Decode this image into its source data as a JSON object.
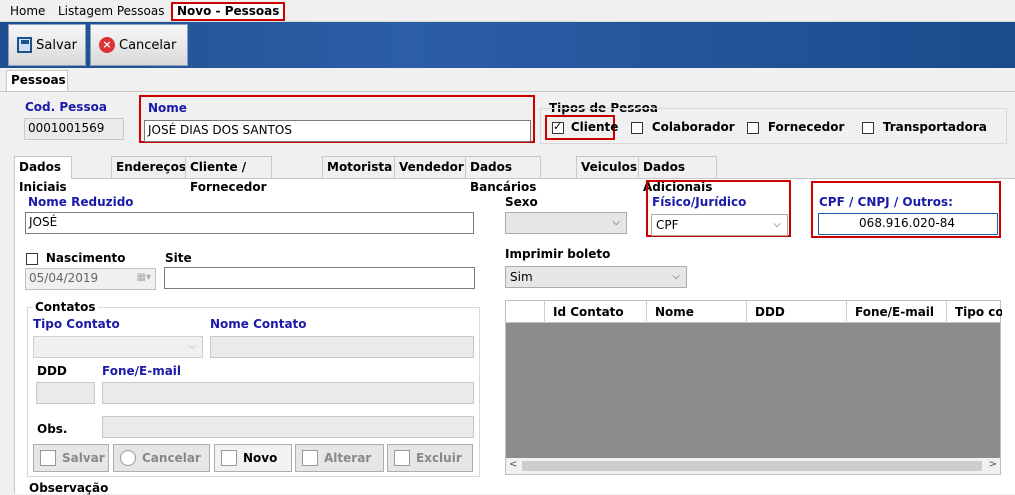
{
  "top_tabs": [
    "Home",
    "Listagem Pessoas",
    "Novo - Pessoas"
  ],
  "toolbar": {
    "save_label": "Salvar",
    "cancel_label": "Cancelar"
  },
  "section_tab": "Pessoas",
  "cod_pessoa": {
    "label": "Cod. Pessoa",
    "value": "0001001569"
  },
  "nome": {
    "label": "Nome",
    "value": "JOSÉ DIAS DOS SANTOS"
  },
  "tipos_pessoa": {
    "label": "Tipos de Pessoa",
    "options": [
      {
        "label": "Cliente",
        "checked": true
      },
      {
        "label": "Colaborador",
        "checked": false
      },
      {
        "label": "Fornecedor",
        "checked": false
      },
      {
        "label": "Transportadora",
        "checked": false
      }
    ]
  },
  "sub_tabs": [
    "Dados Iniciais",
    "Endereços",
    "Cliente / Fornecedor",
    "Motorista",
    "Vendedor",
    "Dados Bancários",
    "Veiculos",
    "Dados Adicionais"
  ],
  "nome_reduzido": {
    "label": "Nome Reduzido",
    "value": "JOSÉ"
  },
  "nascimento": {
    "label": "Nascimento",
    "value": "05/04/2019"
  },
  "site": {
    "label": "Site",
    "value": ""
  },
  "sexo": {
    "label": "Sexo",
    "value": ""
  },
  "fisico_juridico": {
    "label": "Físico/Jurídico",
    "value": "CPF"
  },
  "cpf_cnpj": {
    "label": "CPF / CNPJ / Outros:",
    "value": "068.916.020-84"
  },
  "imprimir_boleto": {
    "label": "Imprimir boleto",
    "value": "Sim"
  },
  "contatos": {
    "title": "Contatos",
    "tipo_contato_label": "Tipo Contato",
    "nome_contato_label": "Nome Contato",
    "ddd_label": "DDD",
    "fone_label": "Fone/E-mail",
    "obs_label": "Obs.",
    "buttons": [
      "Salvar",
      "Cancelar",
      "Novo",
      "Alterar",
      "Excluir"
    ]
  },
  "grid_columns": [
    "Id Contato",
    "Nome",
    "DDD",
    "Fone/E-mail",
    "Tipo con"
  ],
  "observacao_label": "Observação",
  "colors": {
    "toolbar": "#1f4f8f",
    "label_blue": "#1a1aa8",
    "highlight": "#cc0000"
  }
}
